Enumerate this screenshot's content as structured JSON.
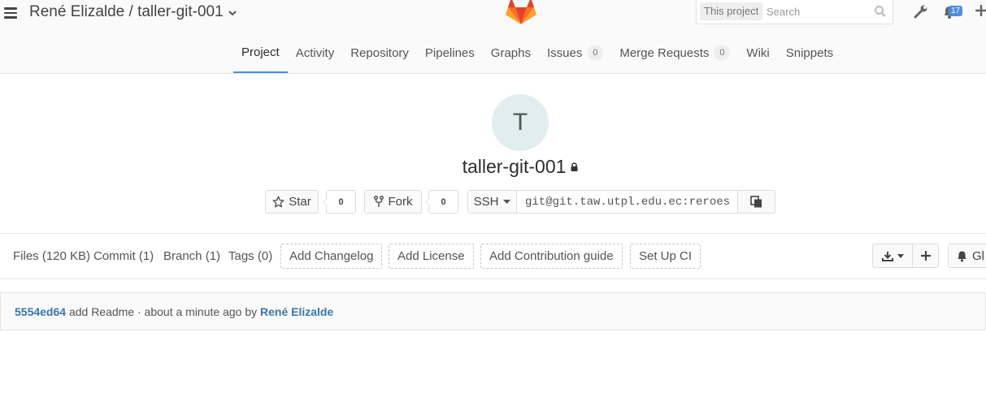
{
  "header": {
    "breadcrumb": "René Elizalde / taller-git-001",
    "search": {
      "scope": "This project",
      "placeholder": "Search"
    },
    "notification_count": "17",
    "icons": [
      "menu-icon",
      "chevron-down-icon",
      "gitlab-logo",
      "search-icon",
      "wrench-icon",
      "bell-icon",
      "plus-icon"
    ]
  },
  "nav": {
    "project": "Project",
    "activity": "Activity",
    "repository": "Repository",
    "pipelines": "Pipelines",
    "graphs": "Graphs",
    "issues": "Issues",
    "issues_count": "0",
    "merge_requests": "Merge Requests",
    "merge_requests_count": "0",
    "wiki": "Wiki",
    "snippets": "Snippets",
    "active": "Project"
  },
  "project": {
    "avatar_letter": "T",
    "name": "taller-git-001",
    "visibility_icon": "lock-icon",
    "star_label": "Star",
    "star_count": "0",
    "fork_label": "Fork",
    "fork_count": "0",
    "clone_protocol": "SSH",
    "clone_url": "git@git.taw.utpl.edu.ec:reroes"
  },
  "stats": {
    "files": "Files (120 KB)",
    "commits": "Commit (1)",
    "branches": "Branch (1)",
    "tags": "Tags (0)",
    "add_changelog": "Add Changelog",
    "add_license": "Add License",
    "add_contribution": "Add Contribution guide",
    "setup_ci": "Set Up CI",
    "notification_label": "Gl"
  },
  "last_commit": {
    "sha": "5554ed64",
    "message": "add Readme · about a minute ago by",
    "author": "René Elizalde"
  },
  "colors": {
    "link": "#3777b0",
    "active_tab": "#4a90d9",
    "badge": "#4c8ee0",
    "avatar_bg": "#e0eef0"
  }
}
